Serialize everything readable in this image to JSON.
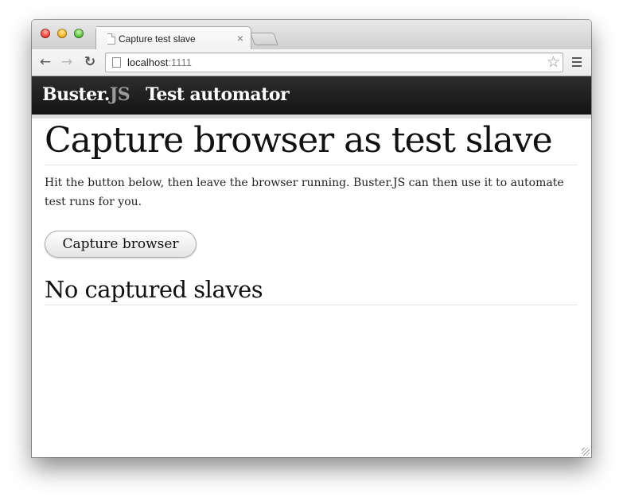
{
  "browser": {
    "tab_title": "Capture test slave",
    "tab_close": "×",
    "url_host": "localhost",
    "url_port": ":1111"
  },
  "site": {
    "brand_main": "Buster.",
    "brand_suffix": "JS",
    "nav_link": "Test automator"
  },
  "main": {
    "title": "Capture browser as test slave",
    "description": "Hit the button below, then leave the browser running. Buster.JS can then use it to automate test runs for you.",
    "capture_button": "Capture browser",
    "slaves_heading": "No captured slaves"
  },
  "icons": {
    "back": "arrow-left-icon",
    "forward": "arrow-right-icon",
    "reload": "reload-icon",
    "bookmark": "star-icon",
    "menu": "menu-icon",
    "page": "page-icon"
  }
}
